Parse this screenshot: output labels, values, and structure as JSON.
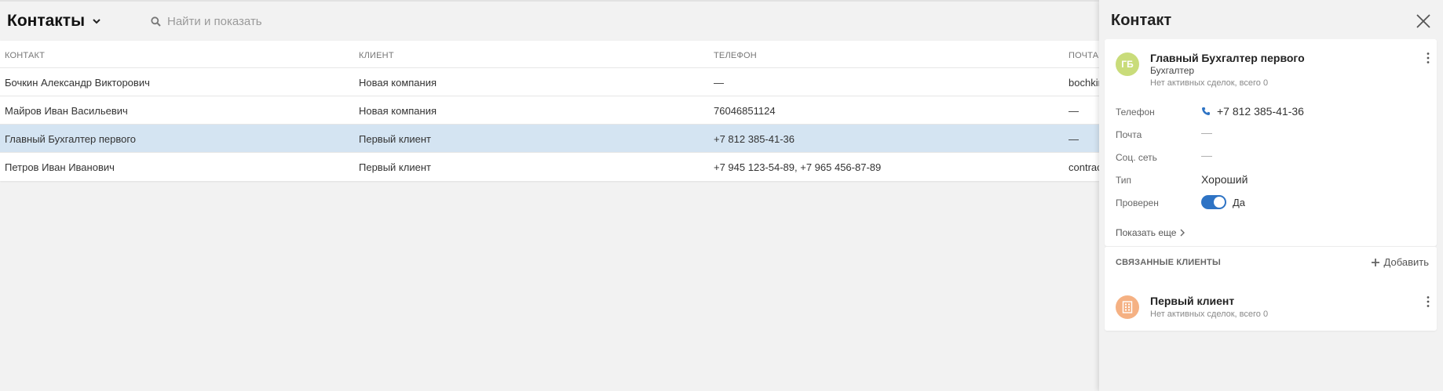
{
  "header": {
    "title": "Контакты",
    "search_placeholder": "Найти и показать"
  },
  "table": {
    "columns": [
      "КОНТАКТ",
      "КЛИЕНТ",
      "ТЕЛЕФОН",
      "ПОЧТА"
    ],
    "rows": [
      {
        "contact": "Бочкин Александр Викторович",
        "client": "Новая компания",
        "phone": "—",
        "email": "bochkin"
      },
      {
        "contact": "Майров Иван Васильевич",
        "client": "Новая компания",
        "phone": "76046851124",
        "email": "—"
      },
      {
        "contact": "Главный Бухгалтер первого",
        "client": "Первый клиент",
        "phone": "+7 812 385-41-36",
        "email": "—"
      },
      {
        "contact": "Петров Иван Иванович",
        "client": "Первый клиент",
        "phone": "+7 945 123-54-89, +7 965 456-87-89",
        "email": "contrac"
      }
    ],
    "selected_row": 2
  },
  "panel": {
    "title": "Контакт",
    "contact": {
      "initials": "ГБ",
      "avatar_color": "#c9dc7a",
      "name": "Главный Бухгалтер первого",
      "role": "Бухгалтер",
      "deals": "Нет активных сделок, всего 0"
    },
    "fields": {
      "phone_label": "Телефон",
      "phone_value": "+7 812 385-41-36",
      "email_label": "Почта",
      "email_value": "—",
      "social_label": "Соц. сеть",
      "social_value": "—",
      "type_label": "Тип",
      "type_value": "Хороший",
      "verified_label": "Проверен",
      "verified_value": "Да"
    },
    "show_more": "Показать еще",
    "related": {
      "heading": "СВЯЗАННЫЕ КЛИЕНТЫ",
      "add_label": "Добавить",
      "client_name": "Первый клиент",
      "client_deals": "Нет активных сделок, всего 0",
      "client_icon_color": "#f5b183"
    }
  },
  "colors": {
    "accent": "#2e73c4",
    "selected_row": "#d4e4f2"
  }
}
